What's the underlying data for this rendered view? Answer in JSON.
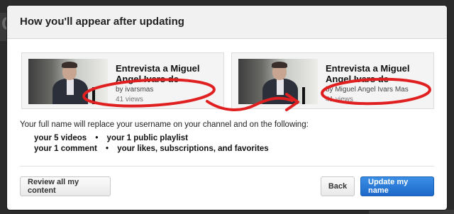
{
  "dialog": {
    "title": "How you'll appear after updating",
    "explanation": "Your full name will replace your username on your channel and on the following:",
    "items": [
      [
        "your 5 videos",
        "your 1 public playlist"
      ],
      [
        "your 1 comment",
        "your likes, subscriptions, and favorites"
      ]
    ],
    "bullet": "•"
  },
  "cards": {
    "before": {
      "title": "Entrevista a Miguel Angel Ivars de",
      "by": "by ivarsmas",
      "views": "41 views"
    },
    "after": {
      "title": "Entrevista a Miguel Angel Ivars de",
      "by": "by Miguel Angel Ivars Mas",
      "views": "41 views"
    }
  },
  "buttons": {
    "review": "Review all my content",
    "back": "Back",
    "update": "Update my name"
  },
  "background": {
    "letter": "C"
  },
  "colors": {
    "annotation": "#e02020",
    "primary": "#2479d8",
    "overlay": "#2b2b2b"
  }
}
